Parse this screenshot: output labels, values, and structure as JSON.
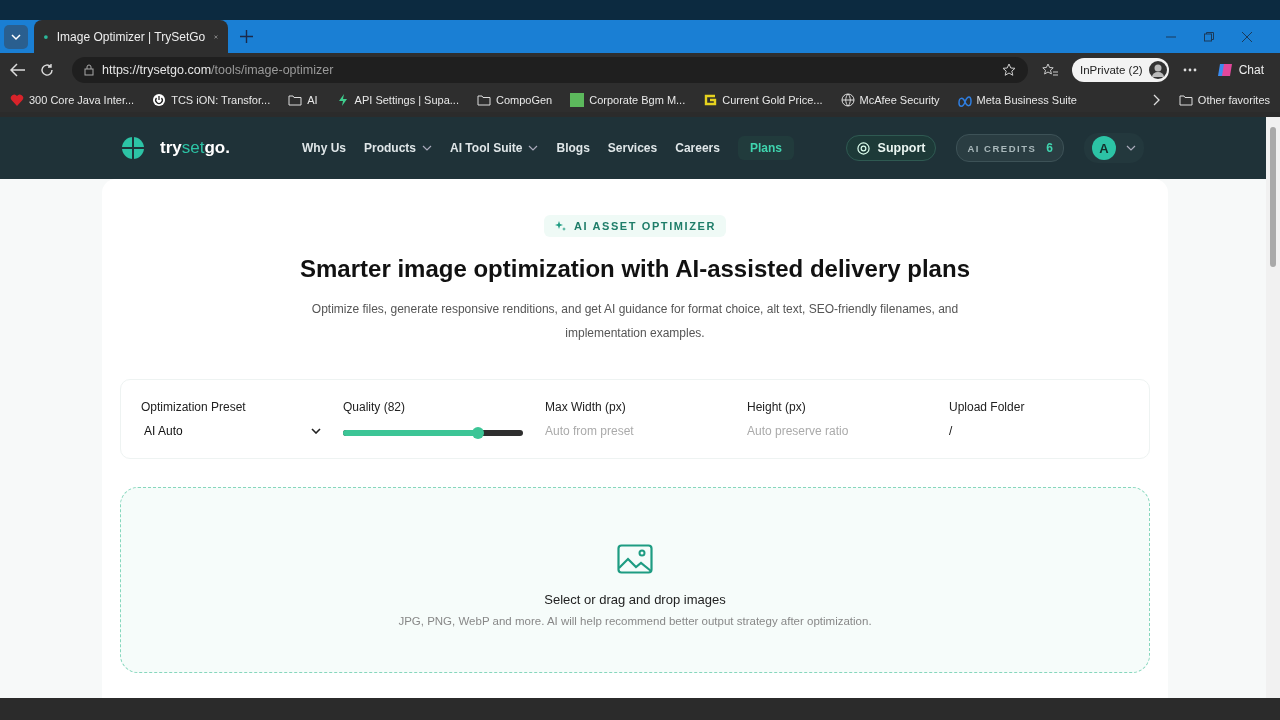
{
  "browser": {
    "tab_title": "Image Optimizer | TrySetGo",
    "url_host": "https://trysetgo.com",
    "url_path": "/tools/image-optimizer",
    "profile": "InPrivate (2)",
    "chat": "Chat",
    "bookmarks": [
      {
        "label": "300 Core Java Inter...",
        "kind": "heart"
      },
      {
        "label": "TCS iON: Transfor...",
        "kind": "power"
      },
      {
        "label": "AI",
        "kind": "folder"
      },
      {
        "label": "API Settings | Supa...",
        "kind": "bolt"
      },
      {
        "label": "CompoGen",
        "kind": "folder"
      },
      {
        "label": "Corporate Bgm M...",
        "kind": "px"
      },
      {
        "label": "Current Gold Price...",
        "kind": "gold"
      },
      {
        "label": "McAfee Security",
        "kind": "globe"
      },
      {
        "label": "Meta Business Suite",
        "kind": "meta"
      }
    ],
    "other_favorites": "Other favorites"
  },
  "site": {
    "logo_a": "try",
    "logo_b": "set",
    "logo_c": "go.",
    "nav": [
      {
        "label": "Why Us",
        "dropdown": false,
        "selected": false
      },
      {
        "label": "Products",
        "dropdown": true,
        "selected": false
      },
      {
        "label": "AI Tool Suite",
        "dropdown": true,
        "selected": false
      },
      {
        "label": "Blogs",
        "dropdown": false,
        "selected": false
      },
      {
        "label": "Services",
        "dropdown": false,
        "selected": false
      },
      {
        "label": "Careers",
        "dropdown": false,
        "selected": false
      },
      {
        "label": "Plans",
        "dropdown": false,
        "selected": true
      }
    ],
    "support": "Support",
    "credits_label": "AI CREDITS",
    "credits_count": "6",
    "avatar": "A"
  },
  "hero": {
    "badge": "AI ASSET OPTIMIZER",
    "title": "Smarter image optimization with AI-assisted delivery plans",
    "subtitle": "Optimize files, generate responsive renditions, and get AI guidance for format choice, alt text, SEO-friendly filenames, and implementation examples."
  },
  "settings": [
    {
      "kind": "select",
      "label": "Optimization Preset",
      "value": "AI Auto"
    },
    {
      "kind": "slider",
      "label": "Quality (82)",
      "level": 0.75
    },
    {
      "kind": "input",
      "label": "Max Width (px)",
      "placeholder": "Auto from preset"
    },
    {
      "kind": "input",
      "label": "Height (px)",
      "placeholder": "Auto preserve ratio"
    },
    {
      "kind": "input",
      "label": "Upload Folder",
      "value": "/"
    }
  ],
  "dropzone": {
    "title": "Select or drag and drop images",
    "hint": "JPG, PNG, WebP and more. AI will help recommend better output strategy after optimization."
  }
}
